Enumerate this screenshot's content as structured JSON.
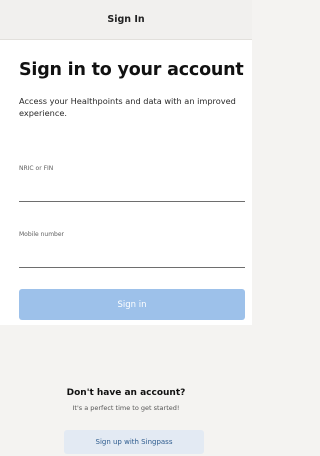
{
  "header": {
    "title": "Sign In"
  },
  "form": {
    "heading": "Sign in to your account",
    "subtitle": "Access your Healthpoints and data with an improved experience.",
    "nric_label": "NRIC or FIN",
    "nric_value": "",
    "mobile_label": "Mobile number",
    "mobile_value": "",
    "submit_label": "Sign in"
  },
  "signup": {
    "heading": "Don't have an account?",
    "subtext": "It's a perfect time to get started!",
    "button_label": "Sign up with Singpass"
  },
  "colors": {
    "primary_disabled": "#9dc1ea",
    "singpass_bg": "#e3eaf3",
    "singpass_text": "#2f5d8f"
  }
}
